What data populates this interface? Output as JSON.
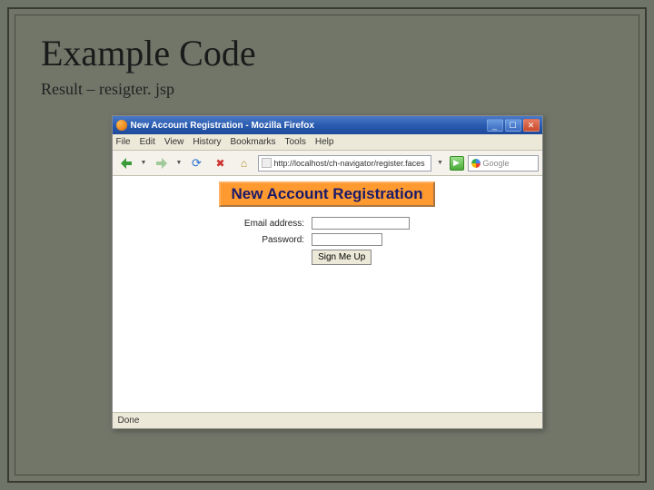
{
  "slide": {
    "title": "Example Code",
    "subtitle": "Result – resigter. jsp"
  },
  "browser": {
    "window_title": "New Account Registration - Mozilla Firefox",
    "menu": {
      "file": "File",
      "edit": "Edit",
      "view": "View",
      "history": "History",
      "bookmarks": "Bookmarks",
      "tools": "Tools",
      "help": "Help"
    },
    "url": "http://localhost/ch-navigator/register.faces",
    "search_placeholder": "Google",
    "go_glyph": "▶",
    "status": "Done"
  },
  "page": {
    "heading": "New Account Registration",
    "labels": {
      "email": "Email address:",
      "password": "Password:"
    },
    "fields": {
      "email": "",
      "password": ""
    },
    "submit": "Sign Me Up"
  }
}
